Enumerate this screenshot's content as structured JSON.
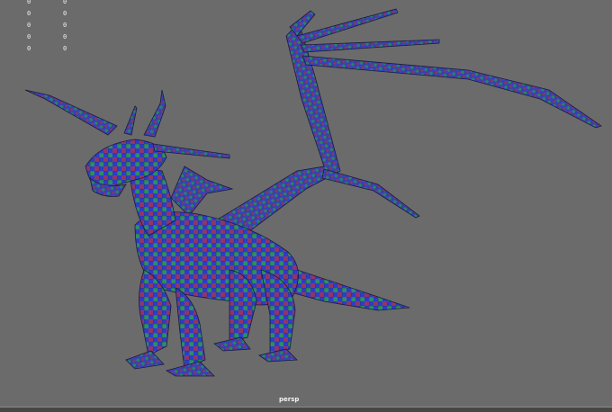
{
  "hud": {
    "rows": [
      {
        "col1": "0",
        "col2": "0"
      },
      {
        "col1": "0",
        "col2": "0"
      },
      {
        "col1": "0",
        "col2": "0"
      },
      {
        "col1": "0",
        "col2": "0"
      },
      {
        "col1": "0",
        "col2": "0"
      }
    ]
  },
  "viewport": {
    "camera_label": "persp",
    "background_color": "#6b6b6b",
    "model": {
      "subject": "dragon",
      "shading": "wireframe on shaded with color-coded UV checker",
      "colors": [
        "#2f3cc8",
        "#2f9a55",
        "#b8343a"
      ]
    }
  }
}
